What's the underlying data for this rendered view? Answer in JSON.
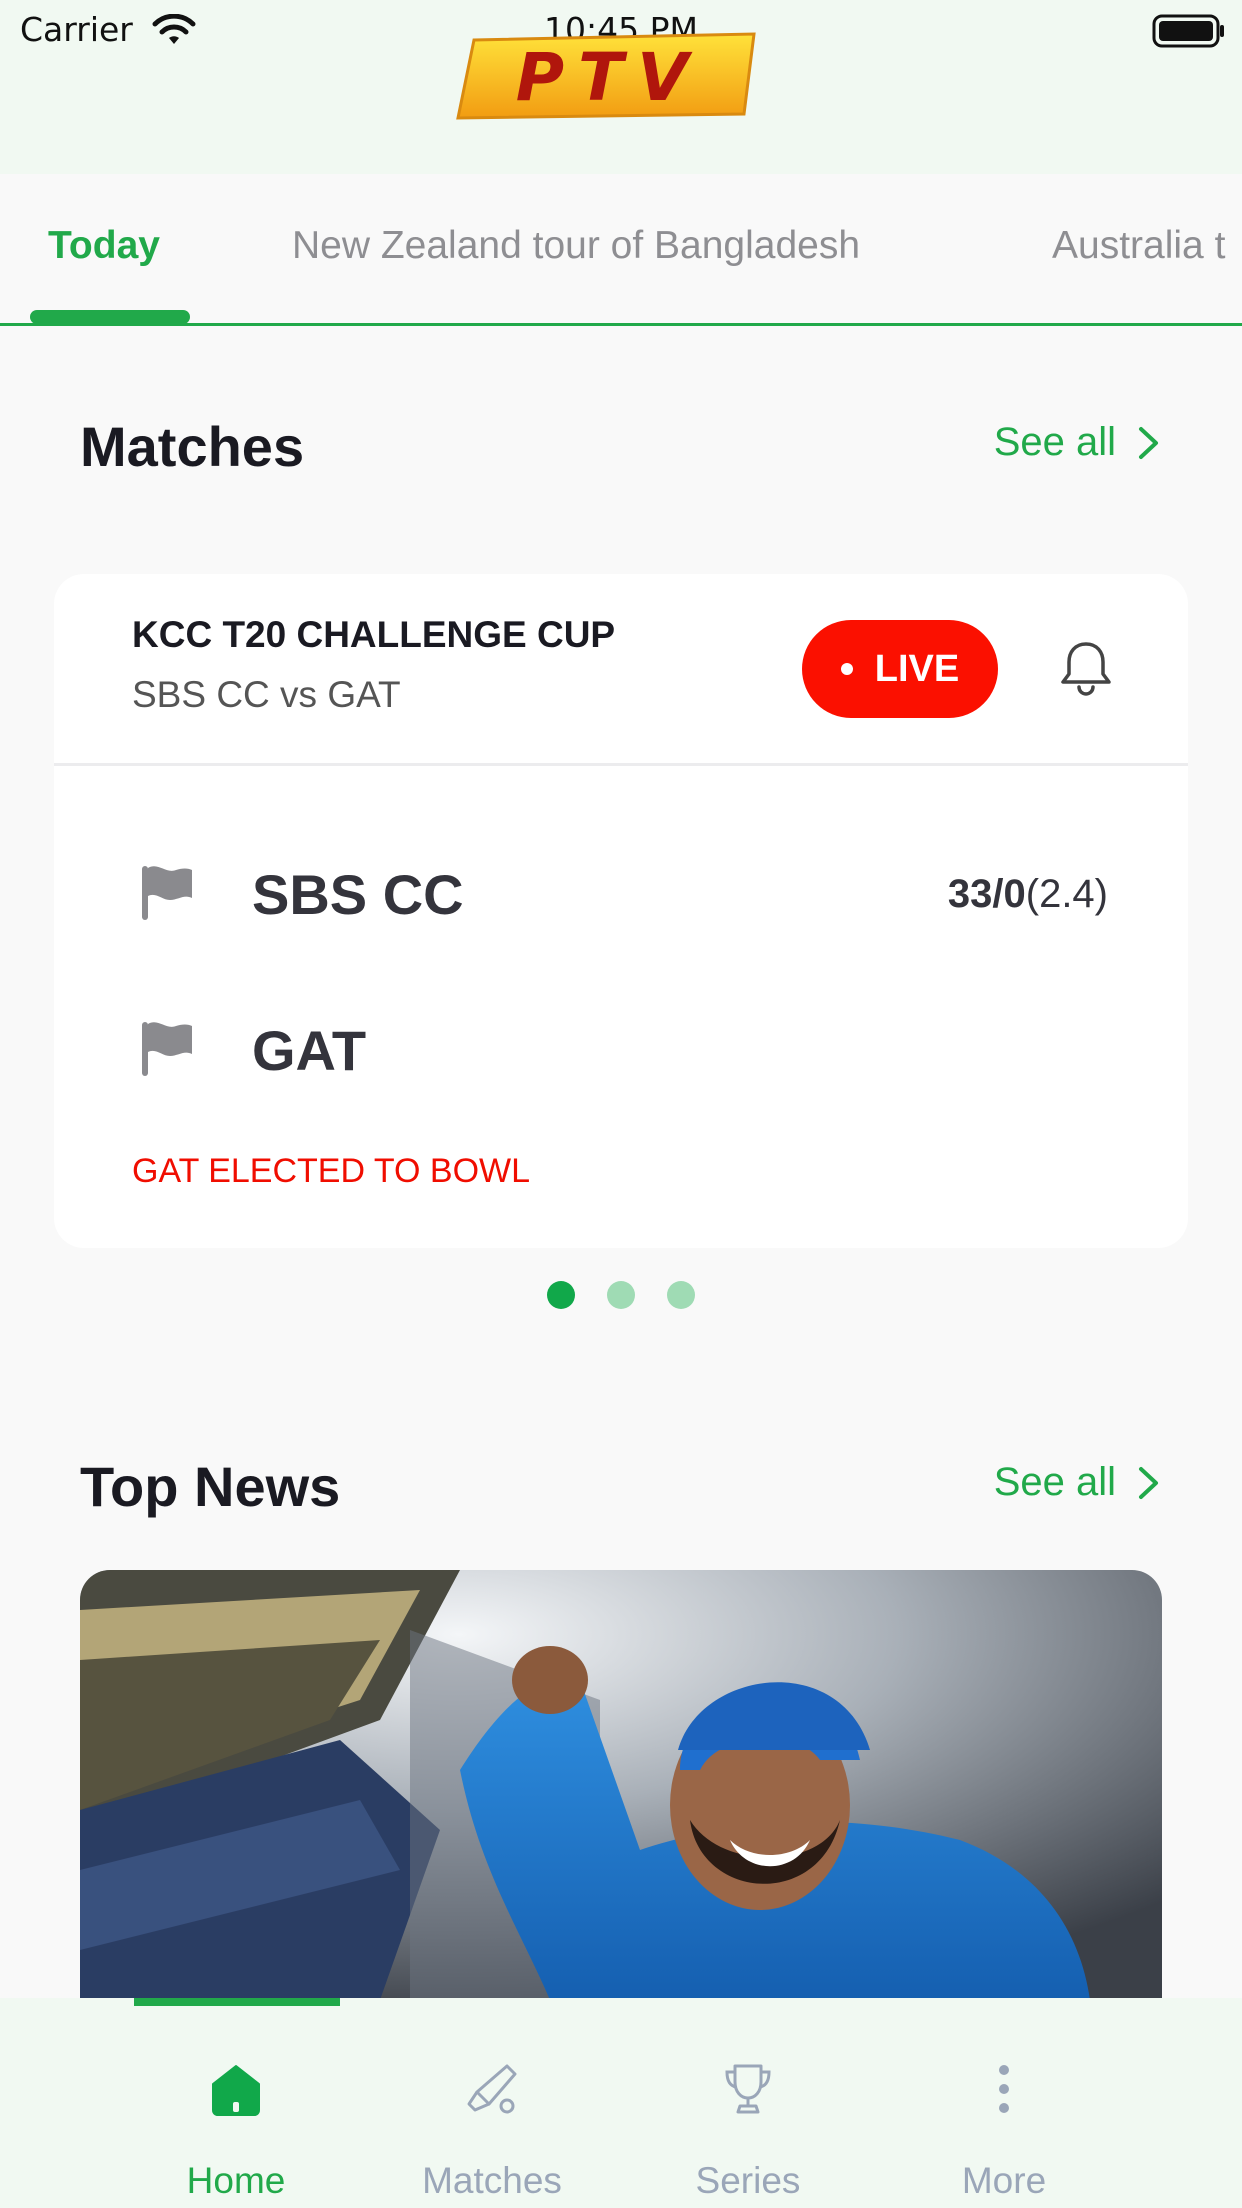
{
  "status_bar": {
    "carrier": "Carrier",
    "time": "10:45 PM"
  },
  "header": {
    "logo_text": "PTV"
  },
  "tabs": [
    {
      "label": "Today",
      "active": true
    },
    {
      "label": "New Zealand tour of Bangladesh",
      "active": false
    },
    {
      "label": "Australia t",
      "active": false
    }
  ],
  "matches": {
    "title": "Matches",
    "see_all": "See all",
    "card": {
      "series": "KCC T20 CHALLENGE CUP",
      "fixture": "SBS CC vs GAT",
      "live_label": "LIVE",
      "team1": {
        "name": "SBS CC",
        "score": "33/0",
        "overs": "(2.4)"
      },
      "team2": {
        "name": "GAT"
      },
      "status": "GAT ELECTED TO BOWL"
    },
    "pager": {
      "count": 3,
      "active": 1
    }
  },
  "news": {
    "title": "Top News",
    "see_all": "See all"
  },
  "bottom_nav": [
    {
      "label": "Home",
      "icon": "home-icon",
      "active": true
    },
    {
      "label": "Matches",
      "icon": "cricket-bat-icon",
      "active": false
    },
    {
      "label": "Series",
      "icon": "trophy-icon",
      "active": false
    },
    {
      "label": "More",
      "icon": "more-vertical-icon",
      "active": false
    }
  ],
  "colors": {
    "accent": "#21a94a",
    "live": "#fb1000",
    "header_bg": "#f1f9f2",
    "status_text": "#f00d00"
  }
}
